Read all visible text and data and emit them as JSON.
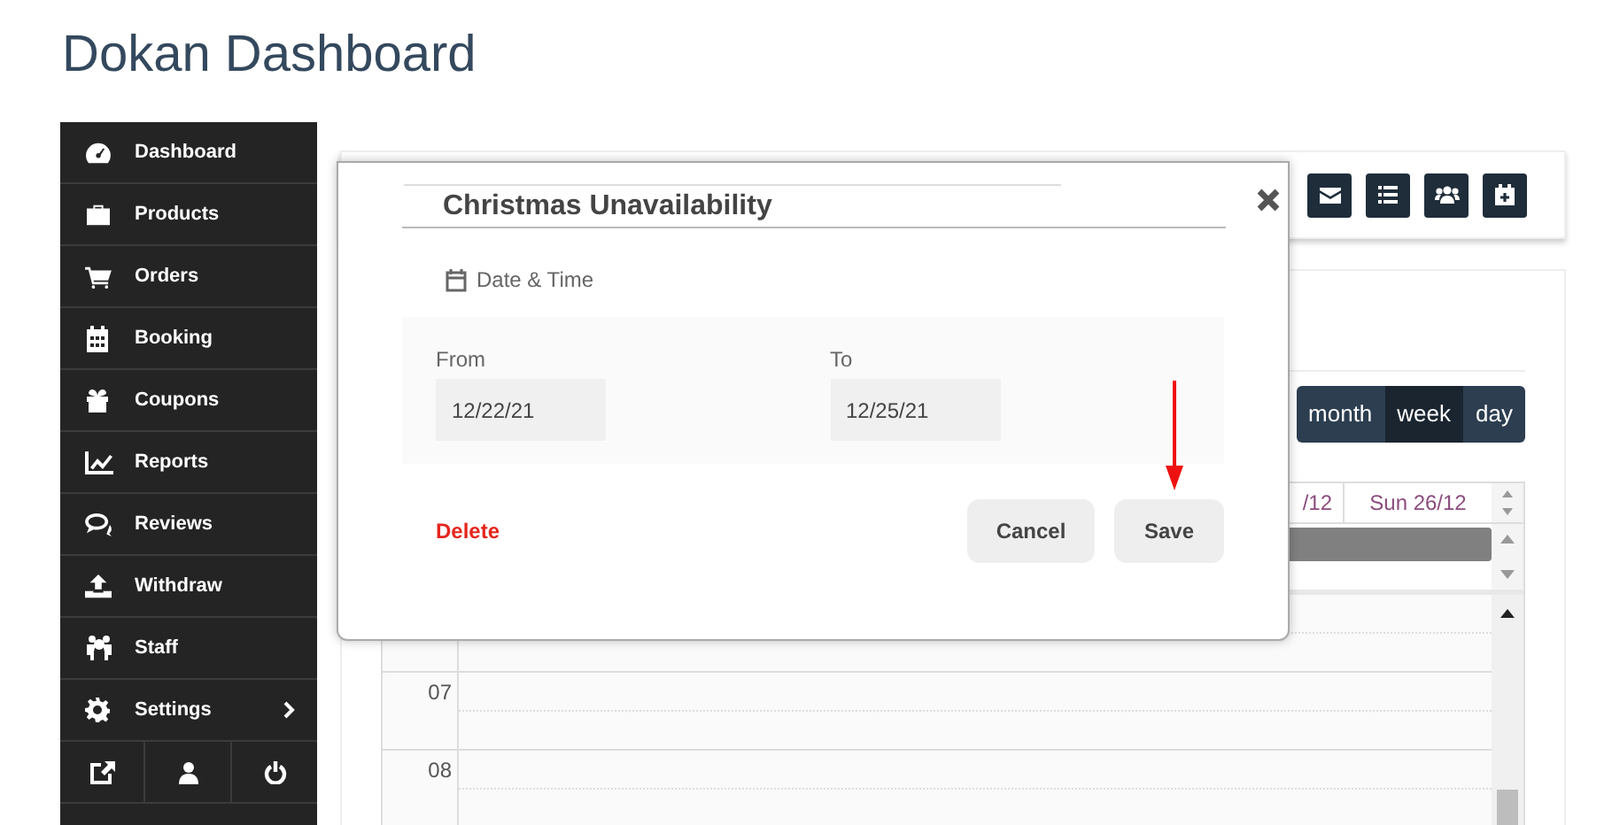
{
  "page_title": "Dokan Dashboard",
  "sidebar": {
    "items": [
      {
        "label": "Dashboard"
      },
      {
        "label": "Products"
      },
      {
        "label": "Orders"
      },
      {
        "label": "Booking"
      },
      {
        "label": "Coupons"
      },
      {
        "label": "Reports"
      },
      {
        "label": "Reviews"
      },
      {
        "label": "Withdraw"
      },
      {
        "label": "Staff"
      },
      {
        "label": "Settings",
        "has_submenu": true
      }
    ]
  },
  "calendar": {
    "views": [
      {
        "label": "month",
        "selected": false
      },
      {
        "label": "week",
        "selected": true
      },
      {
        "label": "day",
        "selected": false
      }
    ],
    "day_headers": [
      "/12",
      "Sun 26/12"
    ],
    "hours": [
      "07",
      "08"
    ]
  },
  "modal": {
    "title": "Christmas Unavailability",
    "section": "Date & Time",
    "from_label": "From",
    "from_value": "12/22/21",
    "to_label": "To",
    "to_value": "12/25/21",
    "delete": "Delete",
    "cancel": "Cancel",
    "save": "Save"
  }
}
